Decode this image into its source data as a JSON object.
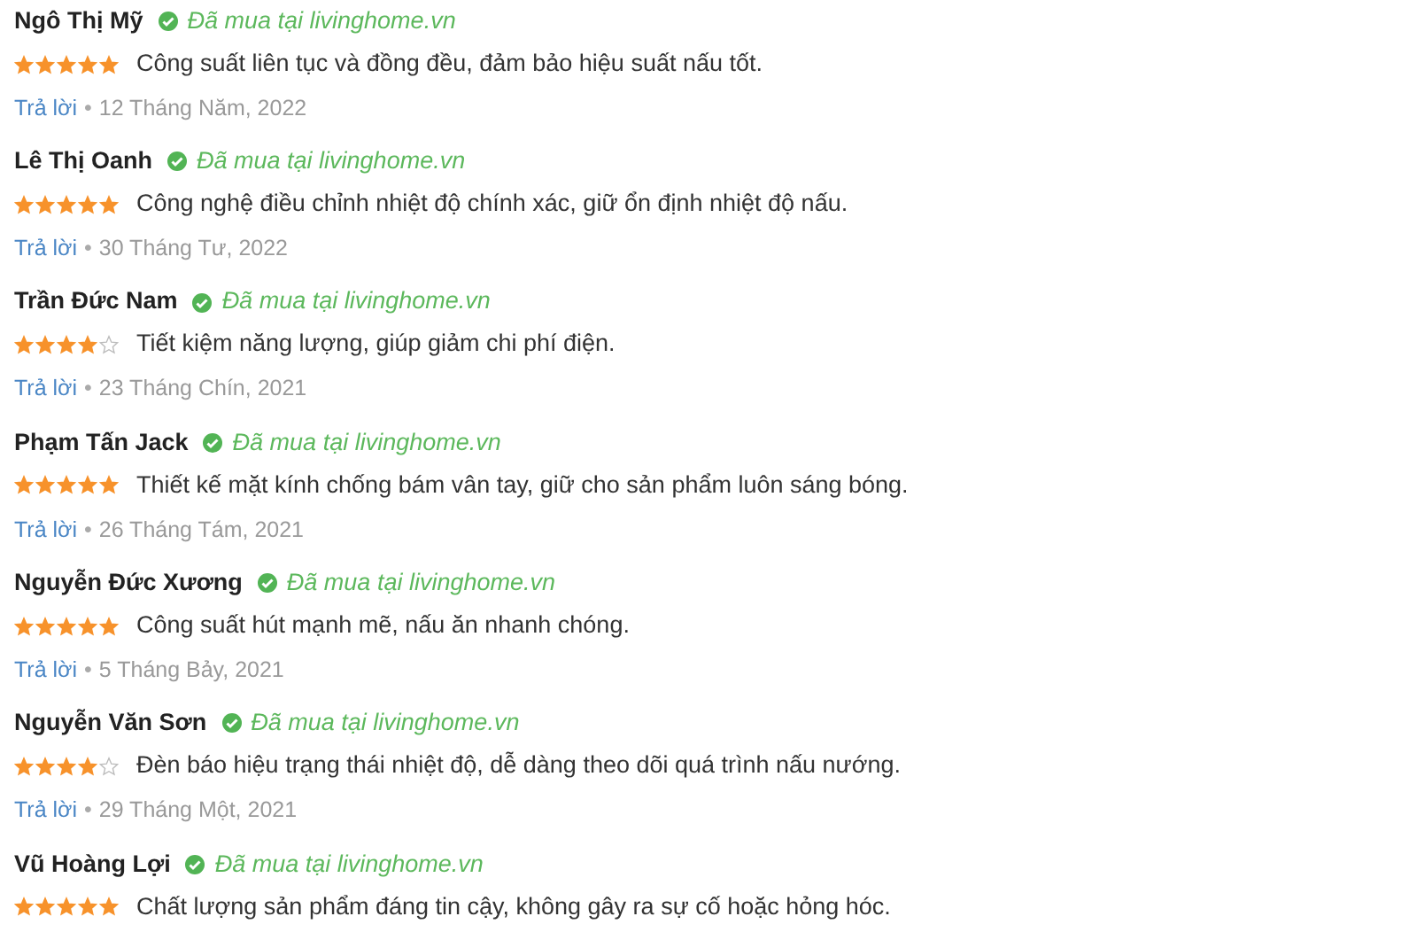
{
  "reviews": [
    {
      "name": "Ngô Thị Mỹ",
      "badge": "Đã mua tại livinghome.vn",
      "stars": 5,
      "comment": "Công suất liên tục và đồng đều, đảm bảo hiệu suất nấu tốt.",
      "reply": "Trả lời",
      "separator": "•",
      "date": "12 Tháng Năm, 2022"
    },
    {
      "name": "Lê Thị Oanh",
      "badge": "Đã mua tại livinghome.vn",
      "stars": 5,
      "comment": "Công nghệ điều chỉnh nhiệt độ chính xác, giữ ổn định nhiệt độ nấu.",
      "reply": "Trả lời",
      "separator": "•",
      "date": "30 Tháng Tư, 2022"
    },
    {
      "name": "Trần Đức Nam",
      "badge": "Đã mua tại livinghome.vn",
      "stars": 4,
      "comment": "Tiết kiệm năng lượng, giúp giảm chi phí điện.",
      "reply": "Trả lời",
      "separator": "•",
      "date": "23 Tháng Chín, 2021"
    },
    {
      "name": "Phạm Tấn Jack",
      "badge": "Đã mua tại livinghome.vn",
      "stars": 5,
      "comment": "Thiết kế mặt kính chống bám vân tay, giữ cho sản phẩm luôn sáng bóng.",
      "reply": "Trả lời",
      "separator": "•",
      "date": "26 Tháng Tám, 2021"
    },
    {
      "name": "Nguyễn Đức Xương",
      "badge": "Đã mua tại livinghome.vn",
      "stars": 5,
      "comment": "Công suất hút mạnh mẽ, nấu ăn nhanh chóng.",
      "reply": "Trả lời",
      "separator": "•",
      "date": "5 Tháng Bảy, 2021"
    },
    {
      "name": "Nguyễn Văn Sơn",
      "badge": "Đã mua tại livinghome.vn",
      "stars": 4,
      "comment": "Đèn báo hiệu trạng thái nhiệt độ, dễ dàng theo dõi quá trình nấu nướng.",
      "reply": "Trả lời",
      "separator": "•",
      "date": "29 Tháng Một, 2021"
    },
    {
      "name": "Vũ Hoàng Lợi",
      "badge": "Đã mua tại livinghome.vn",
      "stars": 5,
      "comment": "Chất lượng sản phẩm đáng tin cậy, không gây ra sự cố hoặc hỏng hóc."
    }
  ]
}
